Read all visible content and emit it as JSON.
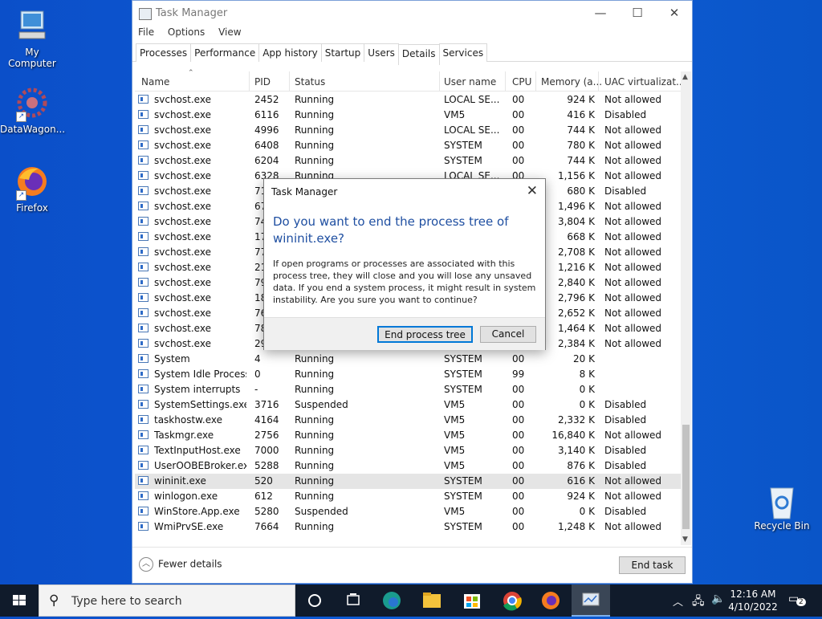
{
  "desktop": {
    "icons": [
      {
        "label": "My Computer"
      },
      {
        "label": "DataWagon..."
      },
      {
        "label": "Firefox"
      },
      {
        "label": "Recycle Bin"
      }
    ]
  },
  "window": {
    "title": "Task Manager",
    "menu": [
      "File",
      "Options",
      "View"
    ],
    "tabs": [
      "Processes",
      "Performance",
      "App history",
      "Startup",
      "Users",
      "Details",
      "Services"
    ],
    "active_tab": "Details",
    "columns": [
      "Name",
      "PID",
      "Status",
      "User name",
      "CPU",
      "Memory (a...",
      "UAC virtualizat..."
    ],
    "rows": [
      [
        "svchost.exe",
        "2452",
        "Running",
        "LOCAL SE...",
        "00",
        "924 K",
        "Not allowed"
      ],
      [
        "svchost.exe",
        "6116",
        "Running",
        "VM5",
        "00",
        "416 K",
        "Disabled"
      ],
      [
        "svchost.exe",
        "4996",
        "Running",
        "LOCAL SE...",
        "00",
        "744 K",
        "Not allowed"
      ],
      [
        "svchost.exe",
        "6408",
        "Running",
        "SYSTEM",
        "00",
        "780 K",
        "Not allowed"
      ],
      [
        "svchost.exe",
        "6204",
        "Running",
        "SYSTEM",
        "00",
        "744 K",
        "Not allowed"
      ],
      [
        "svchost.exe",
        "6328",
        "Running",
        "LOCAL SE...",
        "00",
        "1,156 K",
        "Not allowed"
      ],
      [
        "svchost.exe",
        "71",
        "",
        "",
        "",
        "680 K",
        "Disabled"
      ],
      [
        "svchost.exe",
        "67",
        "",
        "",
        "",
        "1,496 K",
        "Not allowed"
      ],
      [
        "svchost.exe",
        "74",
        "",
        "",
        "",
        "3,804 K",
        "Not allowed"
      ],
      [
        "svchost.exe",
        "17",
        "",
        "",
        "",
        "668 K",
        "Not allowed"
      ],
      [
        "svchost.exe",
        "77",
        "",
        "",
        "",
        "2,708 K",
        "Not allowed"
      ],
      [
        "svchost.exe",
        "21",
        "",
        "",
        "",
        "1,216 K",
        "Not allowed"
      ],
      [
        "svchost.exe",
        "79",
        "",
        "",
        "",
        "2,840 K",
        "Not allowed"
      ],
      [
        "svchost.exe",
        "18",
        "",
        "",
        "",
        "2,796 K",
        "Not allowed"
      ],
      [
        "svchost.exe",
        "76",
        "",
        "",
        "",
        "2,652 K",
        "Not allowed"
      ],
      [
        "svchost.exe",
        "78",
        "",
        "",
        "",
        "1,464 K",
        "Not allowed"
      ],
      [
        "svchost.exe",
        "29",
        "",
        "",
        "",
        "2,384 K",
        "Not allowed"
      ],
      [
        "System",
        "4",
        "Running",
        "SYSTEM",
        "00",
        "20 K",
        ""
      ],
      [
        "System Idle Process",
        "0",
        "Running",
        "SYSTEM",
        "99",
        "8 K",
        ""
      ],
      [
        "System interrupts",
        "-",
        "Running",
        "SYSTEM",
        "00",
        "0 K",
        ""
      ],
      [
        "SystemSettings.exe",
        "3716",
        "Suspended",
        "VM5",
        "00",
        "0 K",
        "Disabled"
      ],
      [
        "taskhostw.exe",
        "4164",
        "Running",
        "VM5",
        "00",
        "2,332 K",
        "Disabled"
      ],
      [
        "Taskmgr.exe",
        "2756",
        "Running",
        "VM5",
        "00",
        "16,840 K",
        "Not allowed"
      ],
      [
        "TextInputHost.exe",
        "7000",
        "Running",
        "VM5",
        "00",
        "3,140 K",
        "Disabled"
      ],
      [
        "UserOOBEBroker.exe",
        "5288",
        "Running",
        "VM5",
        "00",
        "876 K",
        "Disabled"
      ],
      [
        "wininit.exe",
        "520",
        "Running",
        "SYSTEM",
        "00",
        "616 K",
        "Not allowed"
      ],
      [
        "winlogon.exe",
        "612",
        "Running",
        "SYSTEM",
        "00",
        "924 K",
        "Not allowed"
      ],
      [
        "WinStore.App.exe",
        "5280",
        "Suspended",
        "VM5",
        "00",
        "0 K",
        "Disabled"
      ],
      [
        "WmiPrvSE.exe",
        "7664",
        "Running",
        "SYSTEM",
        "00",
        "1,248 K",
        "Not allowed"
      ]
    ],
    "selected_row": "wininit.exe",
    "fewer_details": "Fewer details",
    "end_task": "End task"
  },
  "dialog": {
    "title": "Task Manager",
    "heading": "Do you want to end the process tree of wininit.exe?",
    "body": "If open programs or processes are associated with this process tree, they will close and you will lose any unsaved data. If you end a system process, it might result in system instability. Are you sure you want to continue?",
    "primary": "End process tree",
    "cancel": "Cancel"
  },
  "taskbar": {
    "search_placeholder": "Type here to search",
    "time": "12:16 AM",
    "date": "4/10/2022",
    "notifications": "2"
  },
  "colors": {
    "accent": "#1f4fa1",
    "desktop": "#0e5dd6",
    "taskbar": "#101b2b",
    "selection": "#e5e5e5"
  }
}
